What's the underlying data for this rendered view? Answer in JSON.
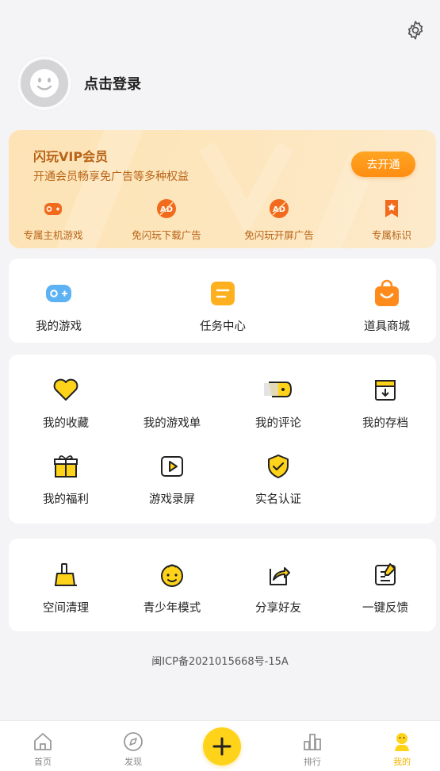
{
  "profile": {
    "login_text": "点击登录"
  },
  "vip": {
    "title": "闪玩VIP会员",
    "subtitle": "开通会员畅享免广告等多种权益",
    "button": "去开通",
    "perks": [
      {
        "label": "专属主机游戏",
        "icon": "gamepad-icon"
      },
      {
        "label": "免闪玩下载广告",
        "icon": "no-ad-icon"
      },
      {
        "label": "免闪玩开屏广告",
        "icon": "no-ad-icon"
      },
      {
        "label": "专属标识",
        "icon": "star-badge-icon"
      }
    ]
  },
  "quick": [
    {
      "label": "我的游戏",
      "icon": "gamepad-icon"
    },
    {
      "label": "任务中心",
      "icon": "task-icon"
    },
    {
      "label": "道具商城",
      "icon": "shopping-bag-icon"
    }
  ],
  "features": [
    {
      "label": "我的收藏",
      "icon": "heart-icon"
    },
    {
      "label": "我的游戏单",
      "icon": "game-list-icon"
    },
    {
      "label": "我的评论",
      "icon": "comment-icon"
    },
    {
      "label": "我的存档",
      "icon": "archive-icon"
    },
    {
      "label": "我的福利",
      "icon": "gift-icon"
    },
    {
      "label": "游戏录屏",
      "icon": "play-icon"
    },
    {
      "label": "实名认证",
      "icon": "shield-check-icon"
    }
  ],
  "tools": [
    {
      "label": "空间清理",
      "icon": "broom-icon"
    },
    {
      "label": "青少年模式",
      "icon": "child-face-icon"
    },
    {
      "label": "分享好友",
      "icon": "share-icon"
    },
    {
      "label": "一键反馈",
      "icon": "feedback-icon"
    }
  ],
  "icp": "闽ICP备2021015668号-15A",
  "tabs": [
    {
      "label": "首页",
      "icon": "home-icon"
    },
    {
      "label": "发现",
      "icon": "compass-icon"
    },
    {
      "label": "",
      "icon": "plus-icon"
    },
    {
      "label": "排行",
      "icon": "ranking-icon"
    },
    {
      "label": "我的",
      "icon": "mine-icon"
    }
  ],
  "colors": {
    "accent": "#ffd31a",
    "vip_text": "#b86417",
    "vip_button": "#ff9a1a",
    "active_tab": "#f0b400"
  }
}
